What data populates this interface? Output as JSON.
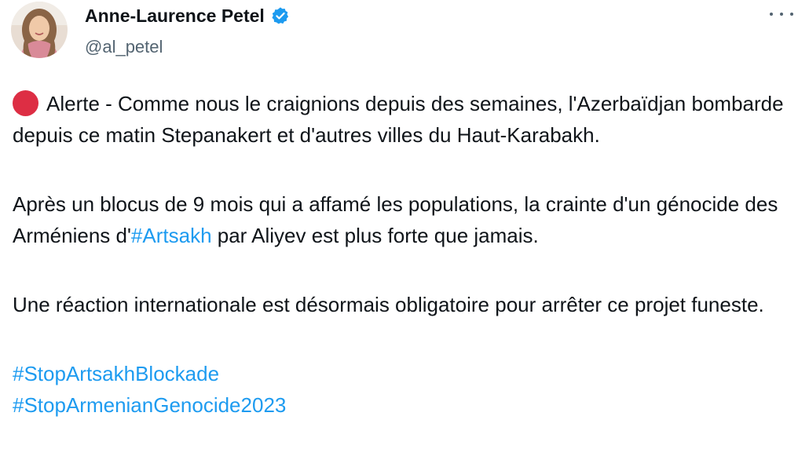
{
  "author": {
    "display_name": "Anne-Laurence Petel",
    "handle": "@al_petel"
  },
  "icons": {
    "verified": "verified-badge-icon",
    "more": "more-options-icon",
    "alert": "red-circle-emoji"
  },
  "colors": {
    "verified_badge": "#1d9bf0",
    "hashtag": "#1d9bf0",
    "alert_circle": "#dd2e44",
    "handle_text": "#536471"
  },
  "tweet": {
    "p1_text": "Alerte - Comme nous le craignions depuis des semaines, l'Azerbaïdjan bombarde depuis ce matin Stepanakert et d'autres villes du Haut-Karabakh.",
    "p2_before": "Après un blocus de 9 mois qui a affamé les populations, la crainte d'un génocide des Arméniens d'",
    "p2_hashtag": "#Artsakh",
    "p2_after": " par Aliyev est plus forte que jamais.",
    "p3_text": "Une réaction internationale est désormais obligatoire pour arrêter ce projet funeste.",
    "hashtags": [
      "#StopArtsakhBlockade",
      "#StopArmenianGenocide2023"
    ]
  }
}
